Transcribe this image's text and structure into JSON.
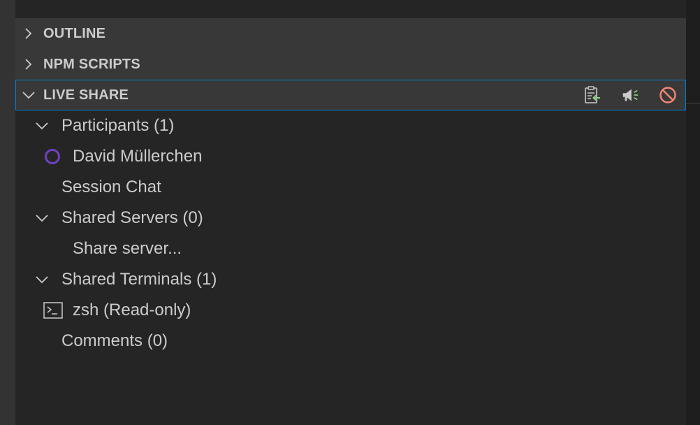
{
  "sections": {
    "outline": {
      "title": "OUTLINE",
      "collapsed": true
    },
    "npm_scripts": {
      "title": "NPM SCRIPTS",
      "collapsed": true
    },
    "live_share": {
      "title": "LIVE SHARE",
      "collapsed": false,
      "focused": true
    }
  },
  "live_share_actions": [
    {
      "name": "copy-link-icon"
    },
    {
      "name": "focus-participants-icon"
    },
    {
      "name": "stop-session-icon",
      "color": "#f48771"
    }
  ],
  "tree": {
    "participants": {
      "label": "Participants (1)",
      "expanded": true
    },
    "participant_1": {
      "label": "David Müllerchen",
      "status_color": "#6f42c1"
    },
    "session_chat": {
      "label": "Session Chat"
    },
    "shared_servers": {
      "label": "Shared Servers (0)",
      "expanded": true
    },
    "share_server": {
      "label": "Share server..."
    },
    "shared_terminals": {
      "label": "Shared Terminals (1)",
      "expanded": true
    },
    "terminal_1": {
      "label": "zsh (Read-only)"
    },
    "comments": {
      "label": "Comments (0)"
    }
  },
  "colors": {
    "sidebar_bg": "#252526",
    "header_bg": "#383838",
    "focus_border": "#007fd4",
    "text": "#cccccc",
    "accent_green": "#89d185",
    "stop_red": "#f48771"
  }
}
